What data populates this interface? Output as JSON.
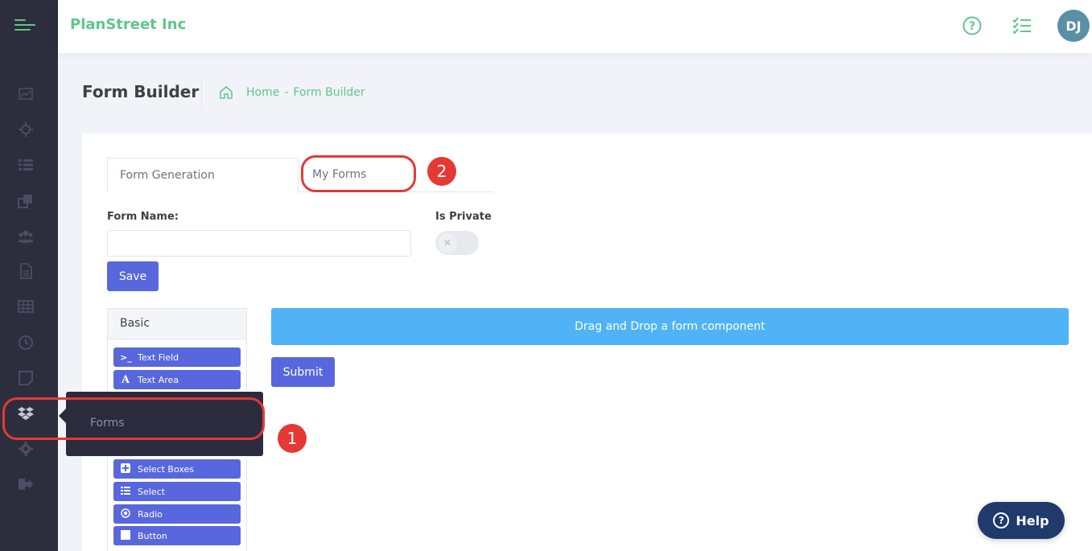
{
  "header": {
    "brand": "PlanStreet Inc",
    "avatar_initials": "DJ"
  },
  "subheader": {
    "title": "Form Builder",
    "breadcrumb": [
      "Home",
      "Form Builder"
    ],
    "separator": "-"
  },
  "tabs": [
    {
      "label": "Form Generation",
      "active": true
    },
    {
      "label": "My Forms",
      "active": false
    }
  ],
  "form": {
    "name_label": "Form Name:",
    "name_value": "",
    "private_label": "Is Private",
    "private_on": false,
    "save_label": "Save"
  },
  "components": {
    "group_label": "Basic",
    "items": [
      {
        "label": "Text Field",
        "icon": ">_"
      },
      {
        "label": "Text Area",
        "icon": "A"
      },
      {
        "label": "Select Boxes",
        "icon": "+"
      },
      {
        "label": "Select",
        "icon": "list"
      },
      {
        "label": "Radio",
        "icon": "radio"
      },
      {
        "label": "Button",
        "icon": "square"
      }
    ]
  },
  "builder": {
    "dropzone_text": "Drag and Drop a form component",
    "submit_label": "Submit"
  },
  "tooltip": {
    "text": "Forms"
  },
  "annotations": {
    "one": "1",
    "two": "2"
  },
  "help": {
    "label": "Help"
  },
  "colors": {
    "sidebar": "#2c2e3e",
    "brand": "#5fc68a",
    "primary": "#5867dd",
    "dropzone": "#4fb3f6",
    "annotation": "#e53935",
    "help": "#1f3a6b"
  }
}
